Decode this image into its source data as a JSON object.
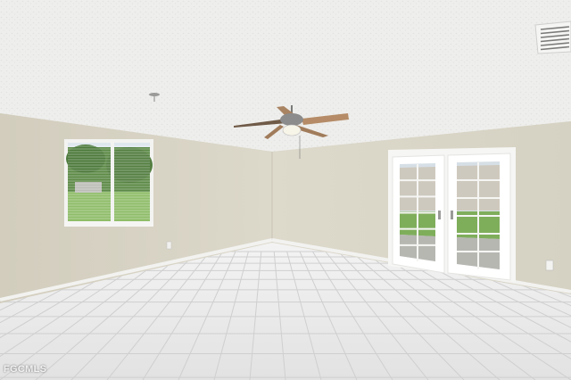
{
  "photo": {
    "watermark": "FGCMLS"
  },
  "palette": {
    "ceiling": "#efefed",
    "wall_left": "#d6d1c2",
    "wall_right": "#dcd8ca",
    "floor": "#e9e9e9",
    "grout": "#c9c9c9",
    "trim": "#f4f4f2",
    "door_frame": "#f7f7f5",
    "glass_sky": "#d8e2ea",
    "grass": "#7fae5b",
    "trees": "#4d7a3c",
    "fan_blade": "#b58c67",
    "fan_body": "#8c8c8c"
  }
}
